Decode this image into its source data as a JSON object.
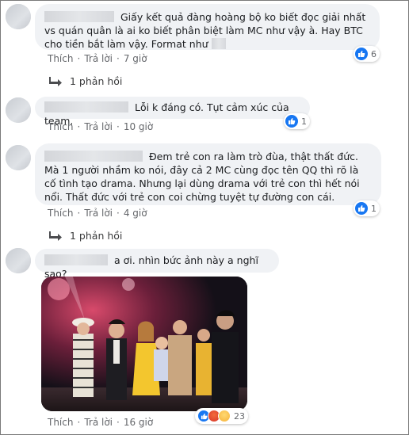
{
  "comments": [
    {
      "text": "Giấy kết quả đàng hoàng bộ ko biết đọc giải nhất vs quán quân là ai ko biết phân biệt làm MC như vậy à. Hay BTC cho tiền bắt làm vậy. Format như",
      "like_label": "Thích",
      "reply_label": "Trả lời",
      "time": "7 giờ",
      "reaction_count": "6"
    },
    {
      "text": "Lỗi k đáng có. Tụt cảm xúc của team.",
      "like_label": "Thích",
      "reply_label": "Trả lời",
      "time": "10 giờ",
      "reaction_count": "1"
    },
    {
      "text": "Đem trẻ con ra làm trò đùa, thật thất đức. Mà 1 người nhầm ko nói, đây cả 2 MC cùng đọc tên QQ thì rõ là cố tình tạo drama. Nhưng lại dùng drama với trẻ con thì hết nói nổi. Thất đức với trẻ con coi chừng tuyệt tự đường con cái.",
      "like_label": "Thích",
      "reply_label": "Trả lời",
      "time": "4 giờ",
      "reaction_count": "1"
    },
    {
      "text": "a ơi. nhìn bức ảnh này a nghĩ sao?",
      "like_label": "Thích",
      "reply_label": "Trả lời",
      "time": "16 giờ",
      "reaction_count": "23"
    }
  ],
  "reply_threads": [
    {
      "label": "1 phản hồi"
    },
    {
      "label": "1 phản hồi"
    }
  ],
  "icons": {
    "like": "like-icon",
    "haha": "haha-icon",
    "angry": "angry-icon",
    "sad": "sad-icon",
    "reply_arrow": "reply-arrow-icon"
  },
  "colors": {
    "bubble": "#f0f2f5",
    "like_blue": "#1877f2",
    "meta_text": "#65676b"
  }
}
